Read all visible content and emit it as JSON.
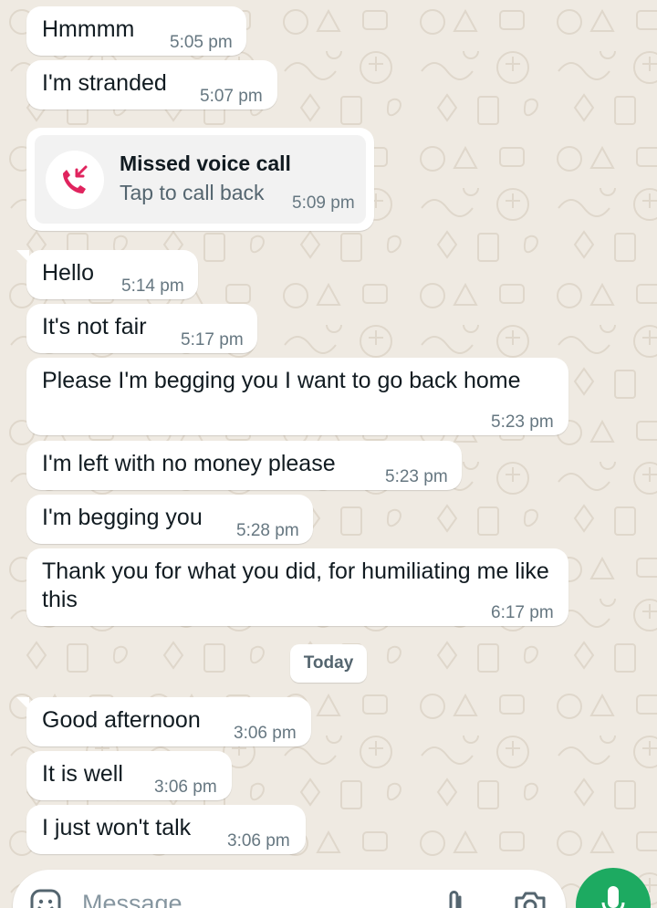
{
  "chat": {
    "messages": [
      {
        "text": "Hmmmm",
        "time": "5:05 pm"
      },
      {
        "text": "I'm stranded",
        "time": "5:07 pm"
      },
      {
        "text": "Hello",
        "time": "5:14 pm"
      },
      {
        "text": "It's not fair",
        "time": "5:17 pm"
      },
      {
        "text": "Please I'm begging you I want to go back home",
        "time": "5:23 pm"
      },
      {
        "text": "I'm left with no money please",
        "time": "5:23 pm"
      },
      {
        "text": "I'm begging you",
        "time": "5:28 pm"
      },
      {
        "text": "Thank you for what you did, for humiliating me like this",
        "time": "6:17 pm"
      },
      {
        "text": "Good afternoon",
        "time": "3:06 pm"
      },
      {
        "text": "It is well",
        "time": "3:06 pm"
      },
      {
        "text": "I just won't talk",
        "time": "3:06 pm"
      }
    ],
    "missed_call": {
      "title": "Missed voice call",
      "subtitle": "Tap to call back",
      "time": "5:09 pm",
      "icon": "missed-call-icon"
    },
    "date_divider": "Today"
  },
  "composer": {
    "placeholder": "Message",
    "icons": [
      "emoji-icon",
      "attach-icon",
      "camera-icon",
      "mic-icon"
    ]
  },
  "colors": {
    "background": "#efeae2",
    "bubble": "#ffffff",
    "timestamp": "#667781",
    "missed_call_red": "#e0245e",
    "mic_green": "#1daa61"
  }
}
